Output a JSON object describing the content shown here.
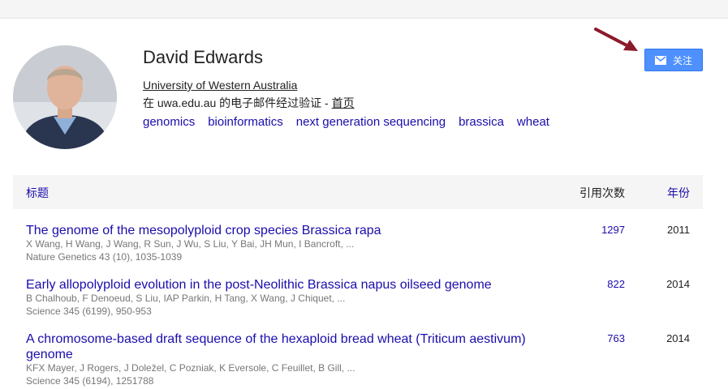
{
  "profile": {
    "name": "David Edwards",
    "affiliation": "University of Western Australia",
    "email_prefix": "在 uwa.edu.au 的电子邮件经过验证 - ",
    "homepage": "首页",
    "tags": [
      "genomics",
      "bioinformatics",
      "next generation sequencing",
      "brassica",
      "wheat"
    ]
  },
  "follow": {
    "label": "关注",
    "icon": "mail-icon"
  },
  "table": {
    "col_title": "标题",
    "col_cites": "引用次数",
    "col_year": "年份",
    "rows": [
      {
        "title": "The genome of the mesopolyploid crop species Brassica rapa",
        "authors": "X Wang, H Wang, J Wang, R Sun, J Wu, S Liu, Y Bai, JH Mun, I Bancroft, ...",
        "venue": "Nature Genetics 43 (10), 1035-1039",
        "cites": "1297",
        "year": "2011"
      },
      {
        "title": "Early allopolyploid evolution in the post-Neolithic Brassica napus oilseed genome",
        "authors": "B Chalhoub, F Denoeud, S Liu, IAP Parkin, H Tang, X Wang, J Chiquet, ...",
        "venue": "Science 345 (6199), 950-953",
        "cites": "822",
        "year": "2014"
      },
      {
        "title": "A chromosome-based draft sequence of the hexaploid bread wheat (Triticum aestivum) genome",
        "authors": "KFX Mayer, J Rogers, J Doležel, C Pozniak, K Eversole, C Feuillet, B Gill, ...",
        "venue": "Science 345 (6194), 1251788",
        "cites": "763",
        "year": "2014"
      }
    ]
  },
  "colors": {
    "link": "#1a0dab",
    "button": "#4d90fe",
    "arrow": "#8b1a2b"
  }
}
